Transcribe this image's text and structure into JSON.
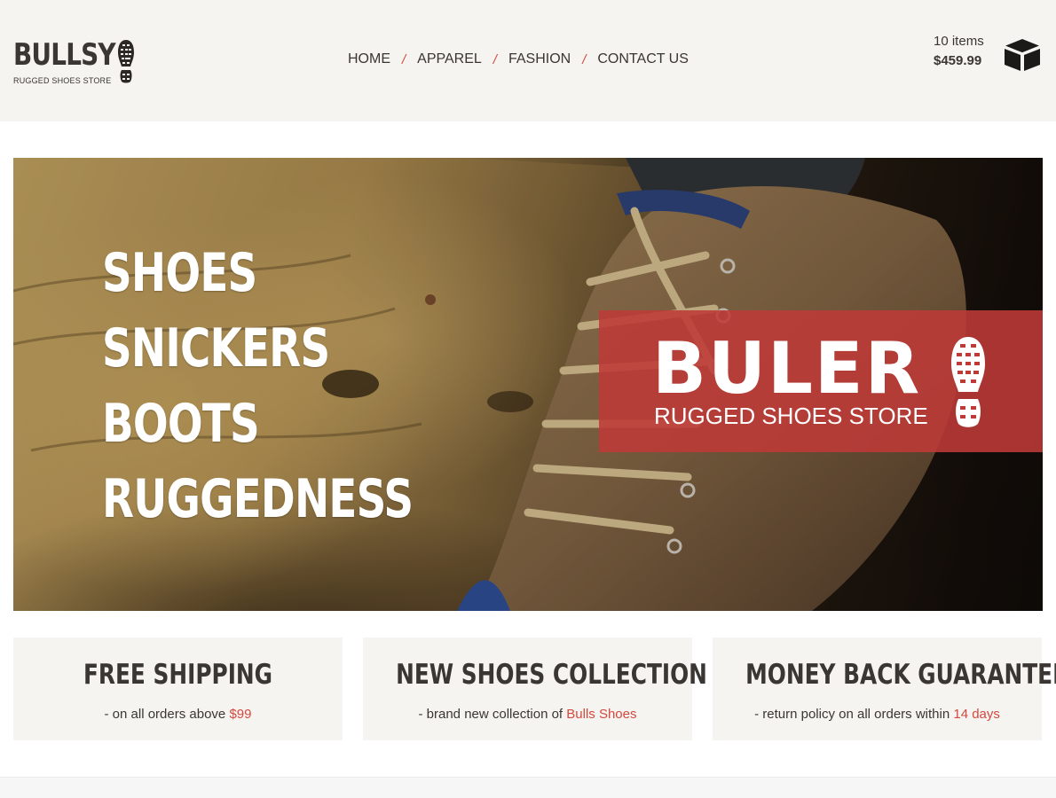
{
  "header": {
    "logo_name": "BULLSY",
    "logo_tagline": "RUGGED SHOES STORE",
    "nav": [
      {
        "label": "HOME"
      },
      {
        "label": "APPAREL"
      },
      {
        "label": "FASHION"
      },
      {
        "label": "CONTACT US"
      }
    ],
    "nav_separator": "/",
    "cart": {
      "count_text": "10 items",
      "total_text": "$459.99",
      "icon": "box-icon"
    }
  },
  "hero": {
    "words": [
      "SHOES",
      "SNICKERS",
      "BOOTS",
      "RUGGEDNESS"
    ],
    "brand_name": "BULER",
    "brand_tagline": "RUGGED SHOES STORE",
    "brand_icon": "shoe-sole-icon"
  },
  "features": [
    {
      "title": "FREE SHIPPING",
      "desc_prefix": "- on all orders above ",
      "desc_highlight": "$99"
    },
    {
      "title": "NEW SHOES COLLECTION",
      "desc_prefix": "- brand new collection of ",
      "desc_highlight": "Bulls Shoes"
    },
    {
      "title": "MONEY BACK GUARANTEE",
      "desc_prefix": "- return policy on all orders within ",
      "desc_highlight": "14 days"
    }
  ],
  "colors": {
    "accent": "#d4483f",
    "text": "#3a3633",
    "header_bg": "#f5f4f1",
    "brand_box": "#be3a38"
  }
}
